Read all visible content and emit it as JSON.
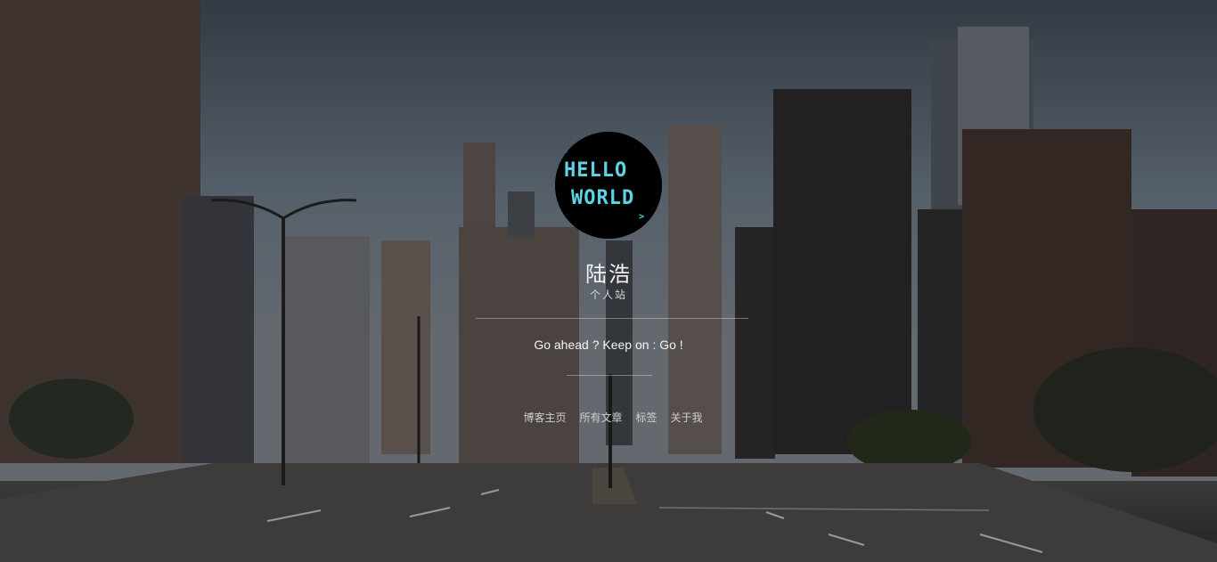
{
  "profile": {
    "avatar_text_line1": "HELLO",
    "avatar_text_line2": "WORLD",
    "title": "陆浩",
    "subtitle": "个人站"
  },
  "motto": "Go ahead ? Keep on : Go !",
  "nav": {
    "items": [
      {
        "label": "博客主页"
      },
      {
        "label": "所有文章"
      },
      {
        "label": "标签"
      },
      {
        "label": "关于我"
      }
    ]
  },
  "colors": {
    "avatar_bg": "#000000",
    "avatar_text": "#5fd3e6",
    "title_text": "#f2f2f2",
    "nav_text": "#cfcfcf"
  },
  "icons": {
    "background": "city-street-photo",
    "avatar": "hello-world-pixel-logo"
  }
}
